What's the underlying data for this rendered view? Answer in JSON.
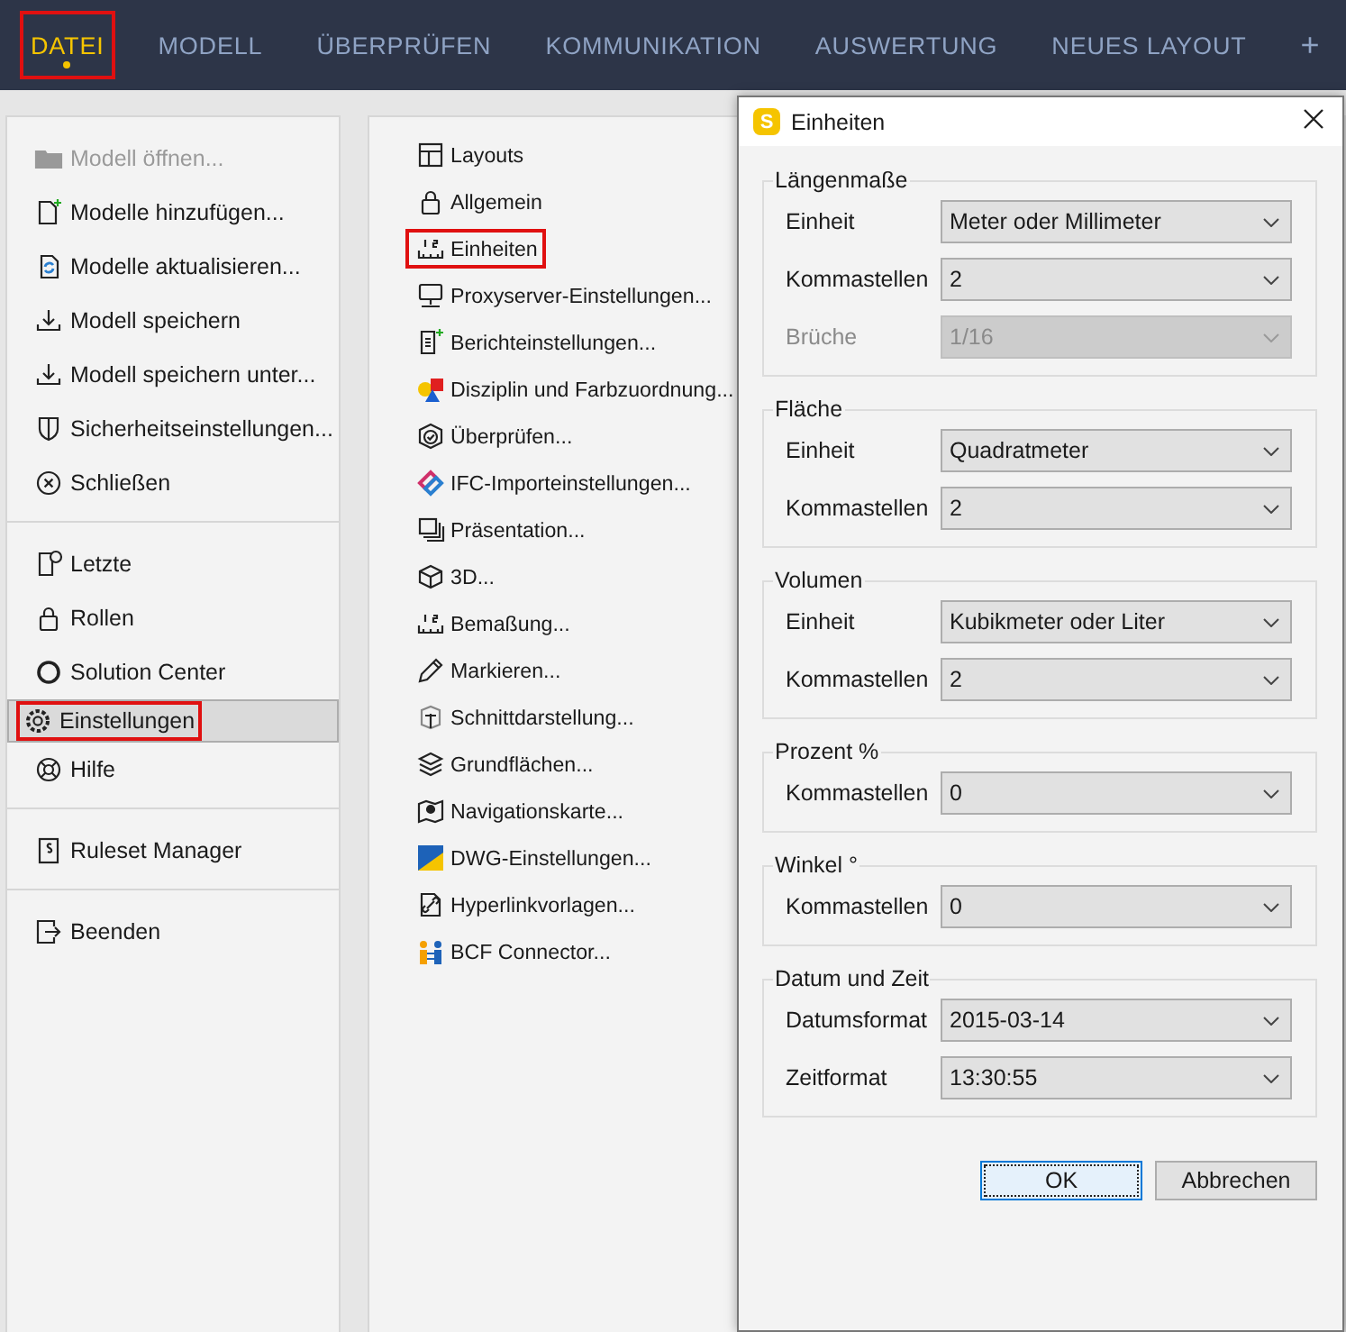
{
  "tabs": [
    {
      "label": "DATEI",
      "selected": true,
      "highlighted": true
    },
    {
      "label": "MODELL",
      "selected": false,
      "highlighted": false
    },
    {
      "label": "ÜBERPRÜFEN",
      "selected": false,
      "highlighted": false
    },
    {
      "label": "KOMMUNIKATION",
      "selected": false,
      "highlighted": false
    },
    {
      "label": "AUSWERTUNG",
      "selected": false,
      "highlighted": false
    },
    {
      "label": "NEUES LAYOUT",
      "selected": false,
      "highlighted": false
    }
  ],
  "add_tab": "+",
  "menu": {
    "groups": [
      {
        "items": [
          {
            "label": "Modell öffnen...",
            "disabled": true,
            "selected": false,
            "highlighted": false
          },
          {
            "label": "Modelle hinzufügen...",
            "disabled": false,
            "selected": false,
            "highlighted": false
          },
          {
            "label": "Modelle aktualisieren...",
            "disabled": false,
            "selected": false,
            "highlighted": false
          },
          {
            "label": "Modell speichern",
            "disabled": false,
            "selected": false,
            "highlighted": false
          },
          {
            "label": "Modell speichern unter...",
            "disabled": false,
            "selected": false,
            "highlighted": false
          },
          {
            "label": "Sicherheitseinstellungen...",
            "disabled": false,
            "selected": false,
            "highlighted": false
          },
          {
            "label": "Schließen",
            "disabled": false,
            "selected": false,
            "highlighted": false
          }
        ]
      },
      {
        "items": [
          {
            "label": "Letzte",
            "disabled": false,
            "selected": false,
            "highlighted": false
          },
          {
            "label": "Rollen",
            "disabled": false,
            "selected": false,
            "highlighted": false
          },
          {
            "label": "Solution Center",
            "disabled": false,
            "selected": false,
            "highlighted": false
          },
          {
            "label": "Einstellungen",
            "disabled": false,
            "selected": true,
            "highlighted": true
          },
          {
            "label": "Hilfe",
            "disabled": false,
            "selected": false,
            "highlighted": false
          }
        ]
      },
      {
        "items": [
          {
            "label": "Ruleset Manager",
            "disabled": false,
            "selected": false,
            "highlighted": false
          }
        ]
      },
      {
        "items": [
          {
            "label": "Beenden",
            "disabled": false,
            "selected": false,
            "highlighted": false
          }
        ]
      }
    ]
  },
  "settings": {
    "items": [
      {
        "label": "Layouts",
        "highlighted": false
      },
      {
        "label": "Allgemein",
        "highlighted": false
      },
      {
        "label": "Einheiten",
        "highlighted": true
      },
      {
        "label": "Proxyserver-Einstellungen...",
        "highlighted": false
      },
      {
        "label": "Berichteinstellungen...",
        "highlighted": false
      },
      {
        "label": "Disziplin und Farbzuordnung...",
        "highlighted": false
      },
      {
        "label": "Überprüfen...",
        "highlighted": false
      },
      {
        "label": "IFC-Importeinstellungen...",
        "highlighted": false
      },
      {
        "label": "Präsentation...",
        "highlighted": false
      },
      {
        "label": "3D...",
        "highlighted": false
      },
      {
        "label": "Bemaßung...",
        "highlighted": false
      },
      {
        "label": "Markieren...",
        "highlighted": false
      },
      {
        "label": "Schnittdarstellung...",
        "highlighted": false
      },
      {
        "label": "Grundflächen...",
        "highlighted": false
      },
      {
        "label": "Navigationskarte...",
        "highlighted": false
      },
      {
        "label": "DWG-Einstellungen...",
        "highlighted": false
      },
      {
        "label": "Hyperlinkvorlagen...",
        "highlighted": false
      },
      {
        "label": "BCF Connector...",
        "highlighted": false
      }
    ]
  },
  "dialog": {
    "title": "Einheiten",
    "app_letter": "S",
    "groups": [
      {
        "title": "Längenmaße",
        "rows": [
          {
            "label": "Einheit",
            "value": "Meter oder Millimeter",
            "disabled": false
          },
          {
            "label": "Kommastellen",
            "value": "2",
            "disabled": false
          },
          {
            "label": "Brüche",
            "value": "1/16",
            "disabled": true
          }
        ]
      },
      {
        "title": "Fläche",
        "rows": [
          {
            "label": "Einheit",
            "value": "Quadratmeter",
            "disabled": false
          },
          {
            "label": "Kommastellen",
            "value": "2",
            "disabled": false
          }
        ]
      },
      {
        "title": "Volumen",
        "rows": [
          {
            "label": "Einheit",
            "value": "Kubikmeter oder Liter",
            "disabled": false
          },
          {
            "label": "Kommastellen",
            "value": "2",
            "disabled": false
          }
        ]
      },
      {
        "title": "Prozent %",
        "rows": [
          {
            "label": "Kommastellen",
            "value": "0",
            "disabled": false
          }
        ]
      },
      {
        "title": "Winkel °",
        "rows": [
          {
            "label": "Kommastellen",
            "value": "0",
            "disabled": false
          }
        ]
      },
      {
        "title": "Datum und Zeit",
        "rows": [
          {
            "label": "Datumsformat",
            "value": "2015-03-14",
            "disabled": false
          },
          {
            "label": "Zeitformat",
            "value": "13:30:55",
            "disabled": false
          }
        ]
      }
    ],
    "buttons": [
      {
        "label": "OK",
        "kind": "default"
      },
      {
        "label": "Abbrechen",
        "kind": "normal"
      }
    ]
  }
}
